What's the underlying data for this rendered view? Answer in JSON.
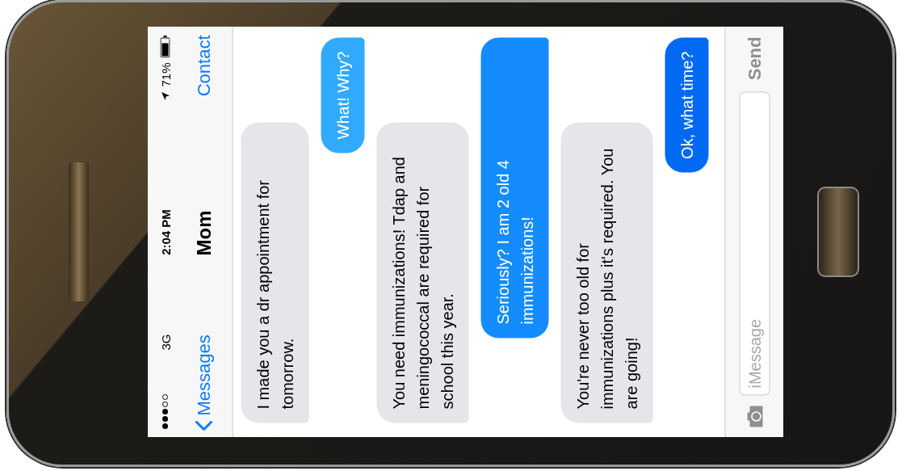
{
  "status_bar": {
    "network": "3G",
    "time": "2:04 PM",
    "battery": "71%"
  },
  "nav_bar": {
    "back": "Messages",
    "title": "Mom",
    "action": "Contact"
  },
  "messages": [
    {
      "kind": "incoming",
      "text": "I made you a dr appointment for tomorrow."
    },
    {
      "kind": "outgoing",
      "text": "What!  Why?"
    },
    {
      "kind": "incoming",
      "text": "You need immunizations! Tdap and meningococcal are required for school this year."
    },
    {
      "kind": "outgoing",
      "text": "Seriously? I am 2 old 4 immunizations!"
    },
    {
      "kind": "incoming",
      "text": "You're never too old for immunizations plus it's required. You are going!"
    },
    {
      "kind": "outgoing",
      "text": "Ok, what time?"
    }
  ],
  "composer": {
    "placeholder": "iMessage",
    "send": "Send",
    "send_disabled": true
  }
}
